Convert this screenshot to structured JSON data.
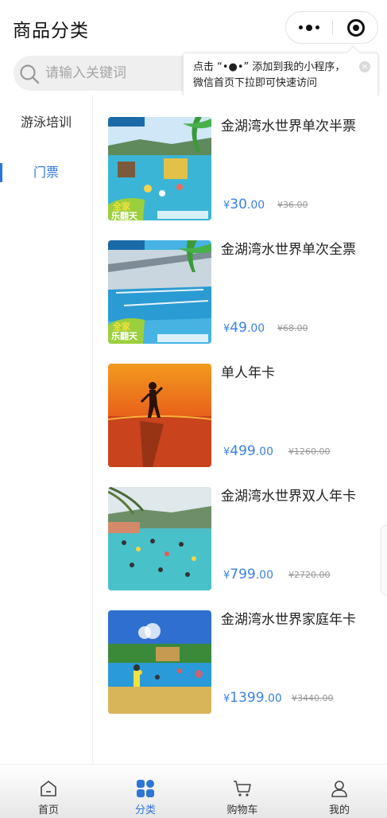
{
  "header": {
    "title": "商品分类"
  },
  "search": {
    "placeholder": "请输入关键词"
  },
  "tooltip": {
    "line1": "点击 “•●•” 添加到我的小程序，",
    "line2": "微信首页下拉即可快速访问",
    "close": "×"
  },
  "sidebar": {
    "items": [
      {
        "label": "游泳培训",
        "active": false
      },
      {
        "label": "门票",
        "active": true
      }
    ]
  },
  "products": [
    {
      "name": "金湖湾水世界单次半票",
      "currency": "¥",
      "price_int": "30",
      "price_dec": ".00",
      "old_price": "¥36.00"
    },
    {
      "name": "金湖湾水世界单次全票",
      "currency": "¥",
      "price_int": "49",
      "price_dec": ".00",
      "old_price": "¥68.00"
    },
    {
      "name": "单人年卡",
      "currency": "¥",
      "price_int": "499",
      "price_dec": ".00",
      "old_price": "¥1260.00"
    },
    {
      "name": "金湖湾水世界双人年卡",
      "currency": "¥",
      "price_int": "799",
      "price_dec": ".00",
      "old_price": "¥2720.00"
    },
    {
      "name": "金湖湾水世界家庭年卡",
      "currency": "¥",
      "price_int": "1399",
      "price_dec": ".00",
      "old_price": "¥3440.00"
    }
  ],
  "tabbar": {
    "items": [
      {
        "label": "首页",
        "icon": "home-icon"
      },
      {
        "label": "分类",
        "icon": "category-icon",
        "active": true
      },
      {
        "label": "购物车",
        "icon": "cart-icon"
      },
      {
        "label": "我的",
        "icon": "user-icon"
      }
    ]
  },
  "colors": {
    "accent": "#2d75d6",
    "price": "#3b82e0"
  }
}
